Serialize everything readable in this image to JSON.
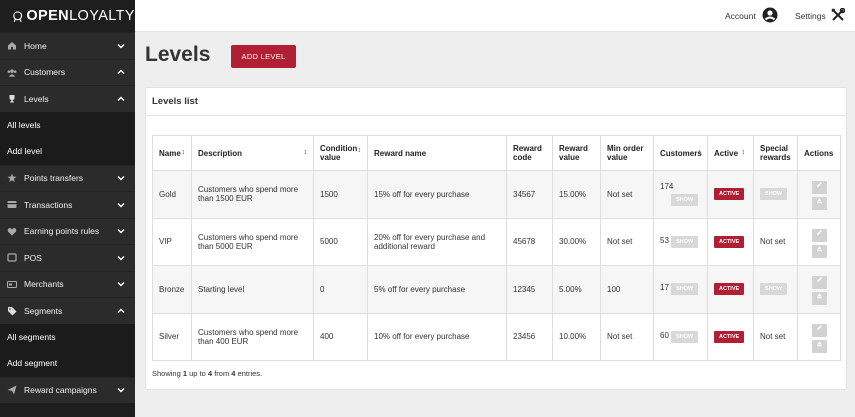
{
  "brand": {
    "logo_bold": "OPEN",
    "logo_rest": "LOYALTY"
  },
  "sidebar": {
    "items": [
      {
        "label": "Home",
        "icon": "home-icon",
        "chevron": "down"
      },
      {
        "label": "Customers",
        "icon": "users-icon",
        "chevron": "up"
      },
      {
        "label": "Levels",
        "icon": "trophy-icon",
        "chevron": "up"
      },
      {
        "label": "All levels",
        "sub": true
      },
      {
        "label": "Add level",
        "sub": true
      },
      {
        "label": "Points transfers",
        "icon": "star-icon",
        "chevron": "down"
      },
      {
        "label": "Transactions",
        "icon": "transactions-icon",
        "chevron": "down"
      },
      {
        "label": "Earning points rules",
        "icon": "heart-icon",
        "chevron": "down"
      },
      {
        "label": "POS",
        "icon": "pos-icon",
        "chevron": "down"
      },
      {
        "label": "Merchants",
        "icon": "merchants-icon",
        "chevron": "down"
      },
      {
        "label": "Segments",
        "icon": "tag-icon",
        "chevron": "up"
      },
      {
        "label": "All segments",
        "sub": true
      },
      {
        "label": "Add segment",
        "sub": true
      },
      {
        "label": "Reward campaigns",
        "icon": "send-icon",
        "chevron": "down"
      }
    ]
  },
  "topbar": {
    "account_label": "Account",
    "settings_label": "Settings"
  },
  "header": {
    "title": "Levels",
    "add_button": "ADD LEVEL"
  },
  "panel": {
    "title": "Levels list"
  },
  "table": {
    "columns": [
      "Name",
      "Description",
      "Condition value",
      "Reward name",
      "Reward code",
      "Reward value",
      "Min order value",
      "Customers",
      "Active",
      "Special rewards",
      "Actions"
    ],
    "badge_active": "ACTIVE",
    "badge_show": "SHOW",
    "rows": [
      {
        "name": "Gold",
        "description": "Customers who spend more than 1500 EUR",
        "condition": "1500",
        "reward_name": "15% off for every purchase",
        "reward_code": "34567",
        "reward_value": "15.00%",
        "min_order": "Not set",
        "customers": "174",
        "special": ""
      },
      {
        "name": "VIP",
        "description": "Customers who spend more than 5000 EUR",
        "condition": "5000",
        "reward_name": "20% off for every purchase and additional reward",
        "reward_code": "45678",
        "reward_value": "30.00%",
        "min_order": "Not set",
        "customers": "53",
        "special": "Not set"
      },
      {
        "name": "Bronze",
        "description": "Starting level",
        "condition": "0",
        "reward_name": "5% off for every purchase",
        "reward_code": "12345",
        "reward_value": "5.00%",
        "min_order": "100",
        "customers": "17",
        "special": ""
      },
      {
        "name": "Silver",
        "description": "Customers who spend more than 400 EUR",
        "condition": "400",
        "reward_name": "10% off for every purchase",
        "reward_code": "23456",
        "reward_value": "10.00%",
        "min_order": "Not set",
        "customers": "60",
        "special": "Not set"
      }
    ]
  },
  "footer": {
    "prefix": "Showing",
    "from": "1",
    "mid1": "up to",
    "to": "4",
    "mid2": "from",
    "total": "4",
    "suffix": "entries."
  },
  "colors": {
    "accent": "#b01f34",
    "sidebar_bg": "#2b2b2b",
    "sidebar_dark": "#1b1b1b",
    "page_bg": "#eeeeee"
  }
}
